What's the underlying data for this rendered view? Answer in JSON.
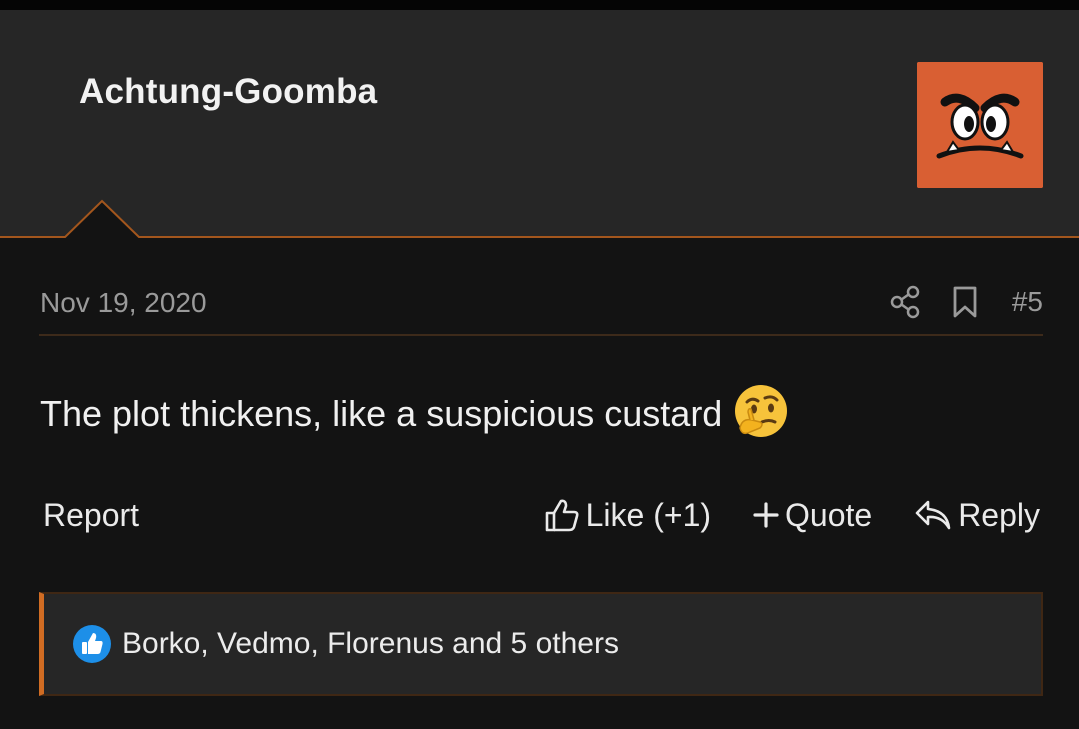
{
  "post": {
    "author": "Achtung-Goomba",
    "date": "Nov 19, 2020",
    "number": "#5",
    "message": "The plot thickens, like a suspicious custard",
    "emoji": "thinking-face-emoji"
  },
  "actions": {
    "report_label": "Report",
    "like_label": "Like (+1)",
    "quote_label": "Quote",
    "reply_label": "Reply"
  },
  "reactions": {
    "summary": "Borko, Vedmo, Florenus and 5 others"
  },
  "icons": {
    "share": "share-icon",
    "bookmark": "bookmark-icon",
    "like": "thumbs-up-icon",
    "quote": "plus-icon",
    "reply": "reply-icon",
    "reaction": "like-reaction-icon"
  },
  "colors": {
    "accent": "#d06c23",
    "avatar_bg": "#d95f33",
    "reaction_blue": "#1d8fe8",
    "header_bg": "#262626",
    "page_bg": "#131313"
  }
}
